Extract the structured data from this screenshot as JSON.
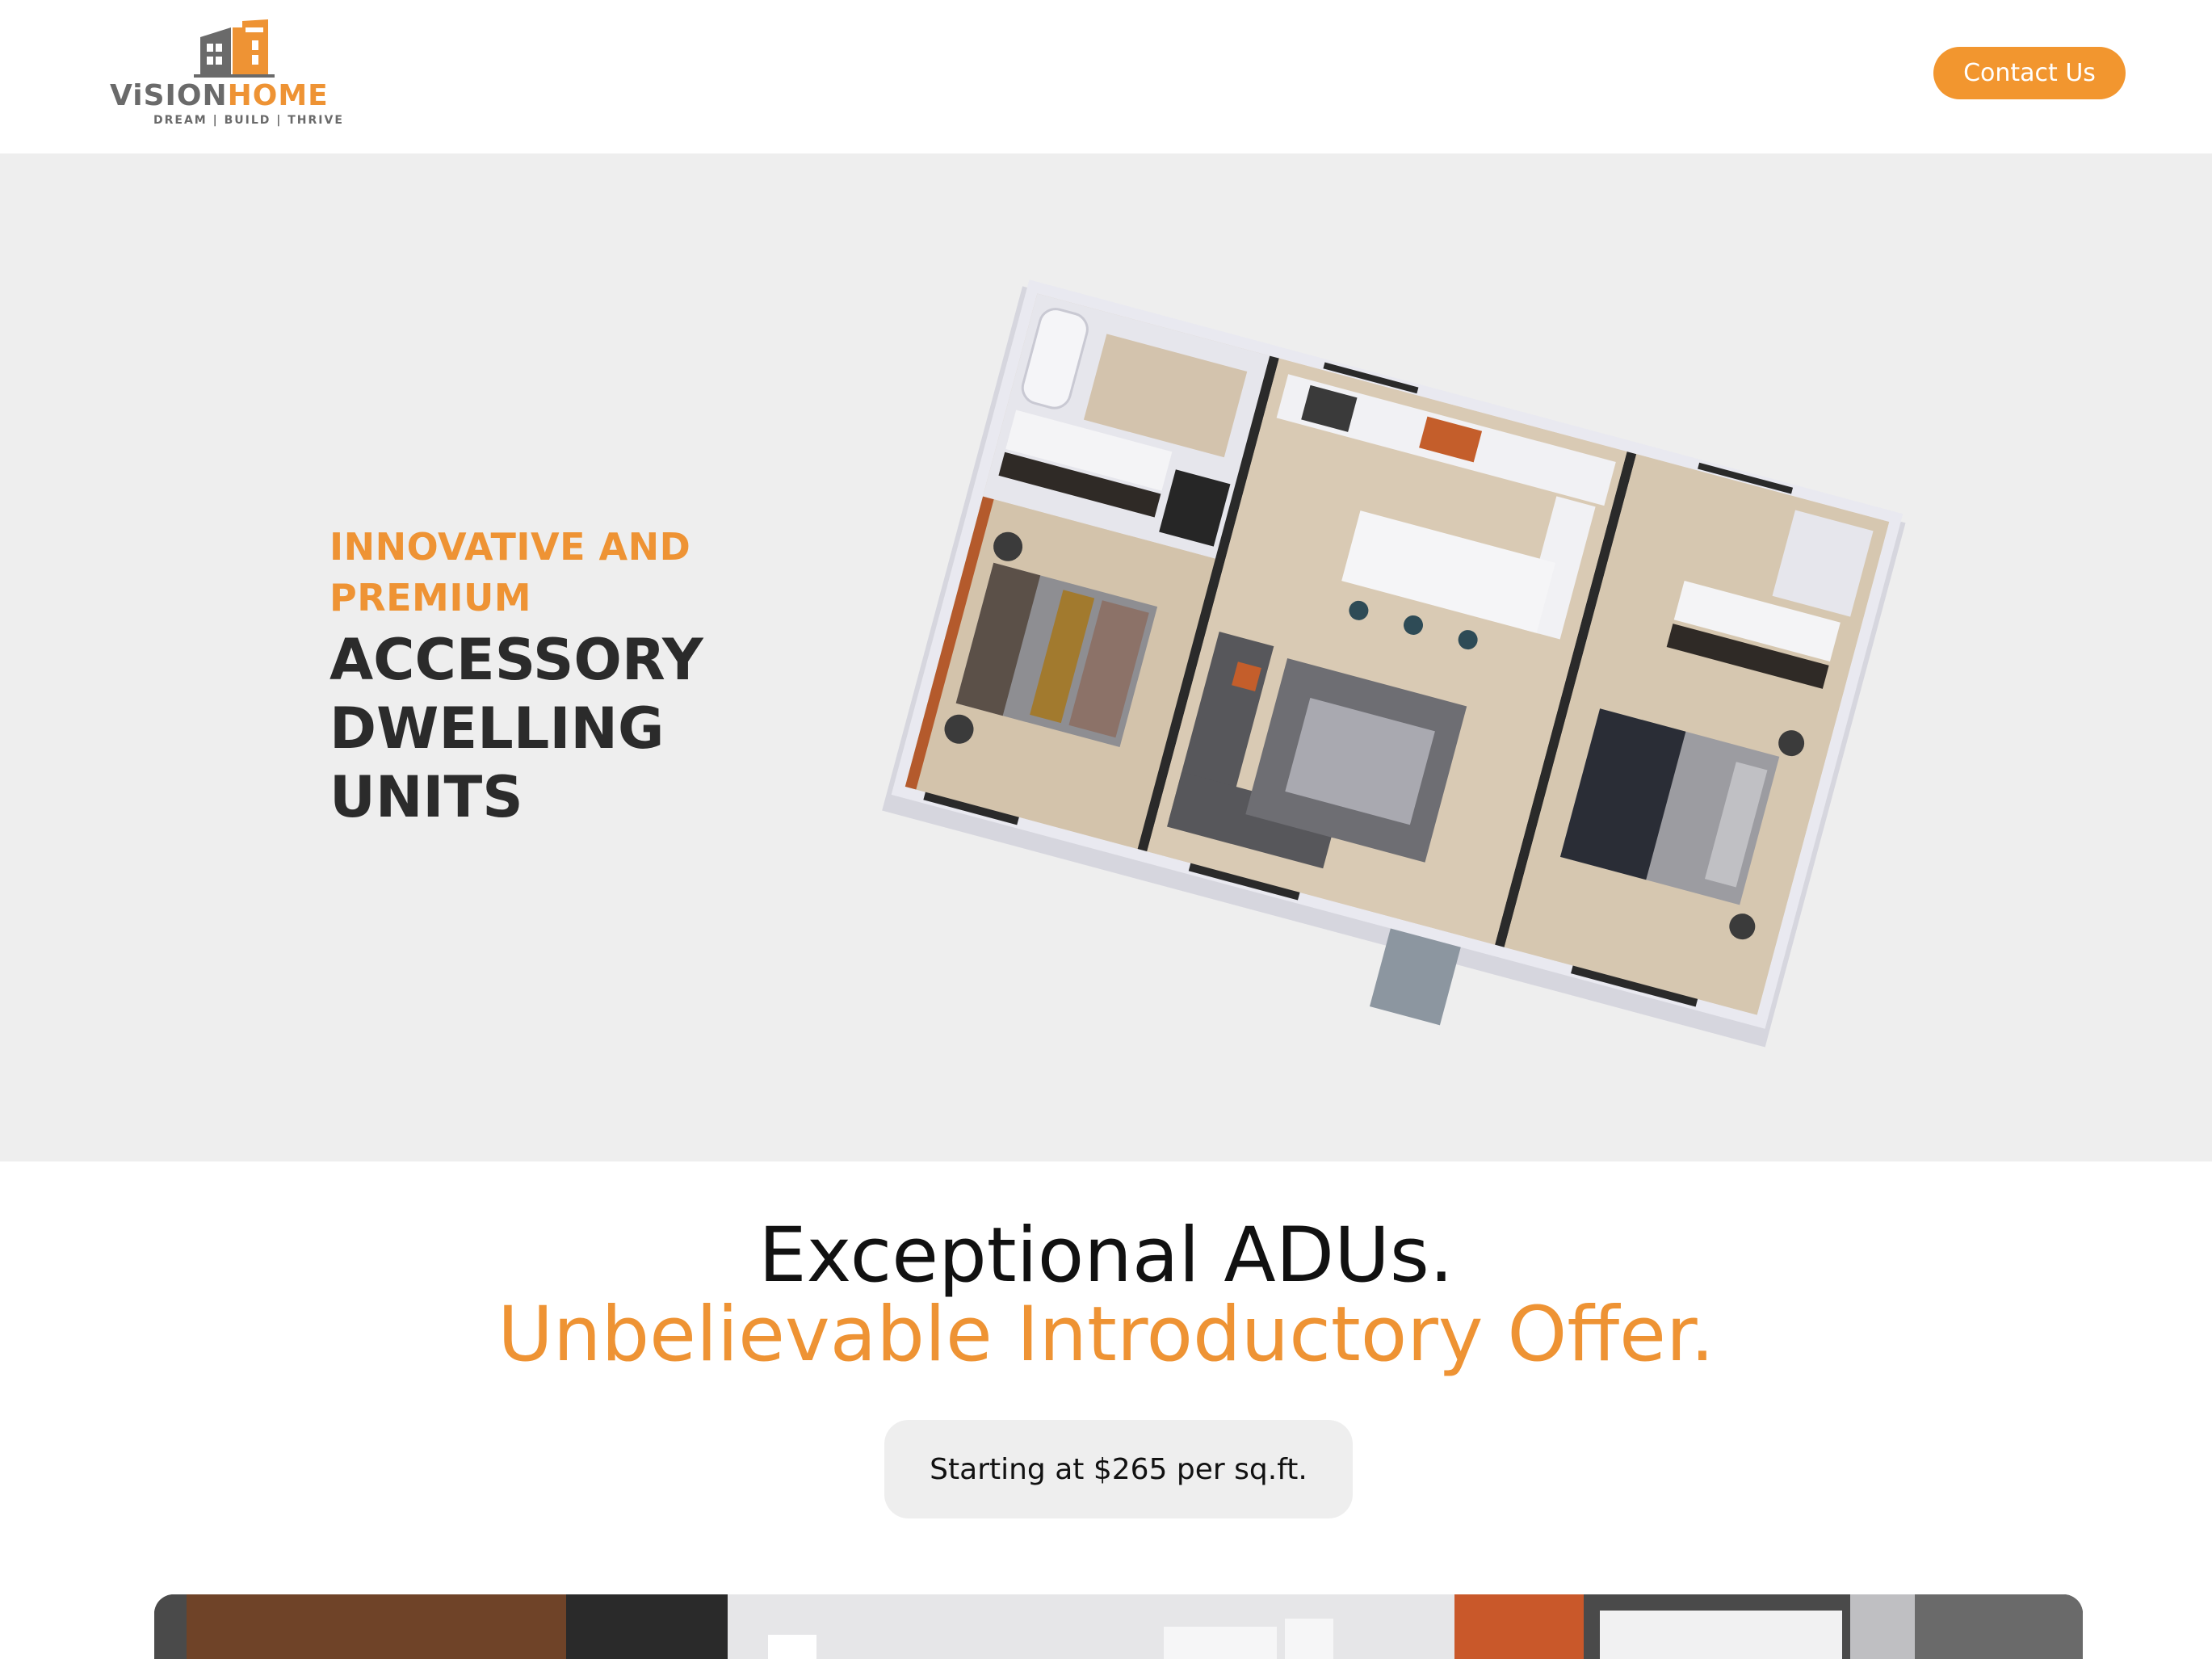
{
  "header": {
    "logo": {
      "word_left": "ViSION",
      "word_right": "HOME",
      "tagline": "DREAM | BUILD | THRIVE",
      "colors": {
        "gray": "#6a6a6a",
        "orange": "#ee9334"
      }
    },
    "contact_label": "Contact Us"
  },
  "hero": {
    "eyebrow_line1": "INNOVATIVE AND",
    "eyebrow_line2": "PREMIUM",
    "headline_line1": "ACCESSORY",
    "headline_line2": "DWELLING",
    "headline_line3": "UNITS",
    "image": "adu-floor-plan-3d-render"
  },
  "offer": {
    "line1": "Exceptional ADUs.",
    "line2": "Unbelievable Introductory Offer.",
    "price": "Starting at $265 per sq.ft."
  },
  "interior_image": "adu-interior-kitchen-photo",
  "colors": {
    "accent": "#f2962f",
    "hero_bg": "#eeeeee",
    "heading_dark": "#2b2b2b"
  }
}
